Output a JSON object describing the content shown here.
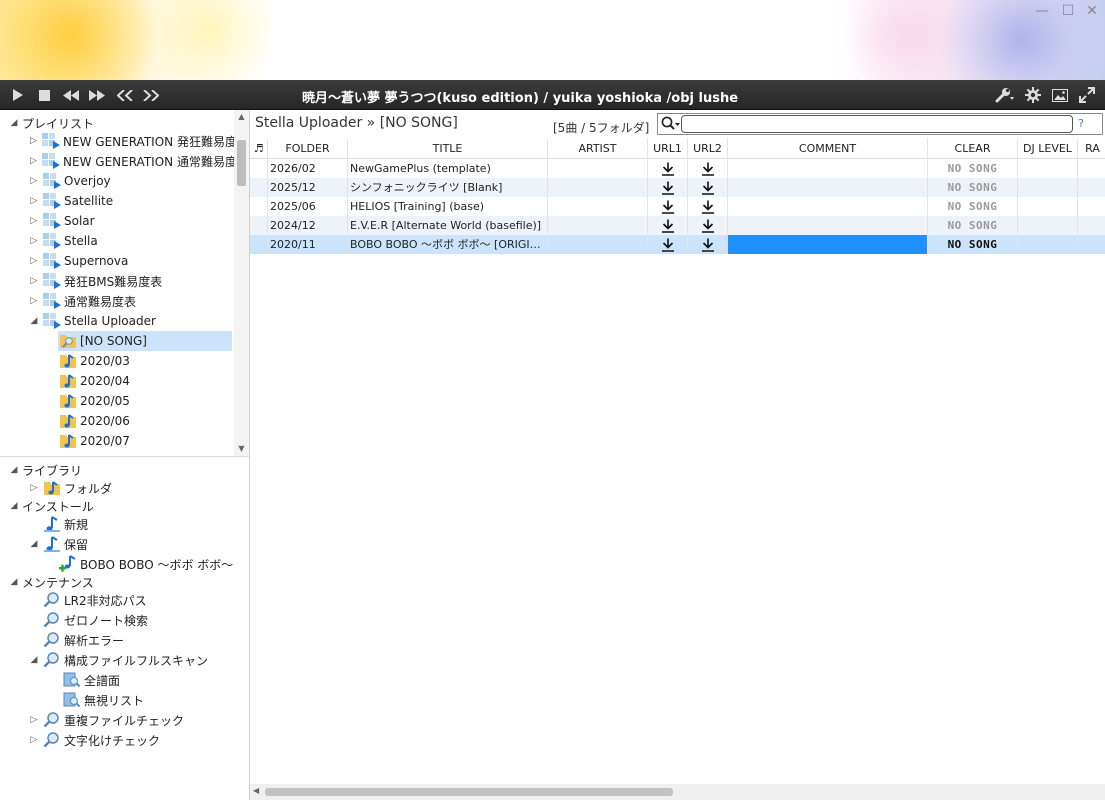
{
  "window": {
    "minimize": "—",
    "maximize": "☐",
    "close": "✕"
  },
  "player": {
    "now_playing": "暁月〜蒼い夢 夢うつつ(kuso edition) / yuika yoshioka /obj lushe",
    "controls": [
      "play-icon",
      "stop-icon",
      "rewind-icon",
      "fast-forward-icon",
      "previous-icon",
      "next-icon"
    ],
    "tools": [
      "wrench-icon",
      "gear-icon",
      "image-icon",
      "fullscreen-icon"
    ]
  },
  "tree_top": {
    "section": "プレイリスト",
    "items": [
      {
        "label": "NEW GENERATION 発狂難易度表"
      },
      {
        "label": "NEW GENERATION 通常難易度表"
      },
      {
        "label": "Overjoy"
      },
      {
        "label": "Satellite"
      },
      {
        "label": "Solar"
      },
      {
        "label": "Stella"
      },
      {
        "label": "Supernova"
      },
      {
        "label": "発狂BMS難易度表"
      },
      {
        "label": "通常難易度表"
      },
      {
        "label": "Stella Uploader"
      }
    ],
    "children": [
      {
        "label": "[NO SONG]"
      },
      {
        "label": "2020/03"
      },
      {
        "label": "2020/04"
      },
      {
        "label": "2020/05"
      },
      {
        "label": "2020/06"
      },
      {
        "label": "2020/07"
      }
    ]
  },
  "tree_bottom": {
    "library": "ライブラリ",
    "folder": "フォルダ",
    "install": "インストール",
    "new": "新規",
    "hold": "保留",
    "hold_item": "BOBO BOBO 〜ボボ ボボ〜 SP",
    "maintenance": "メンテナンス",
    "lr2": "LR2非対応パス",
    "zeronote": "ゼロノート検索",
    "parse_error": "解析エラー",
    "fullscan": "構成ファイルフルスキャン",
    "all_charts": "全譜面",
    "ignore_list": "無視リスト",
    "duplicate": "重複ファイルチェック",
    "mojibake": "文字化けチェック"
  },
  "main": {
    "breadcrumb": "Stella Uploader » [NO SONG]",
    "count": "[5曲 / 5フォルダ]",
    "search_value": "",
    "search_placeholder": "",
    "help": "?",
    "columns": {
      "icon": "♬",
      "folder": "FOLDER",
      "title": "TITLE",
      "artist": "ARTIST",
      "url1": "URL1",
      "url2": "URL2",
      "comment": "COMMENT",
      "clear": "CLEAR",
      "dj_level": "DJ LEVEL",
      "rank": "RA"
    },
    "rows": [
      {
        "folder": "2026/02",
        "title": "NewGamePlus (template)",
        "artist": "",
        "comment": "",
        "clear": "NO SONG",
        "dj_level": ""
      },
      {
        "folder": "2025/12",
        "title": "シンフォニックライツ [Blank]",
        "artist": "",
        "comment": "",
        "clear": "NO SONG",
        "dj_level": ""
      },
      {
        "folder": "2025/06",
        "title": "HELIOS [Training] (base)",
        "artist": "",
        "comment": "",
        "clear": "NO SONG",
        "dj_level": ""
      },
      {
        "folder": "2024/12",
        "title": "E.V.E.R [Alternate World (basefile)]",
        "artist": "",
        "comment": "",
        "clear": "NO SONG",
        "dj_level": ""
      },
      {
        "folder": "2020/11",
        "title": "BOBO BOBO 〜ボボ ボボ〜 [ORIGINAL]",
        "artist": "",
        "comment": "",
        "clear": "NO SONG",
        "dj_level": ""
      }
    ],
    "selected_row": 4
  },
  "colors": {
    "player_bg": "#2e2e2e",
    "selection": "#cce4fb",
    "comment_highlight": "#1e90ff",
    "link": "#4a7bd3"
  }
}
